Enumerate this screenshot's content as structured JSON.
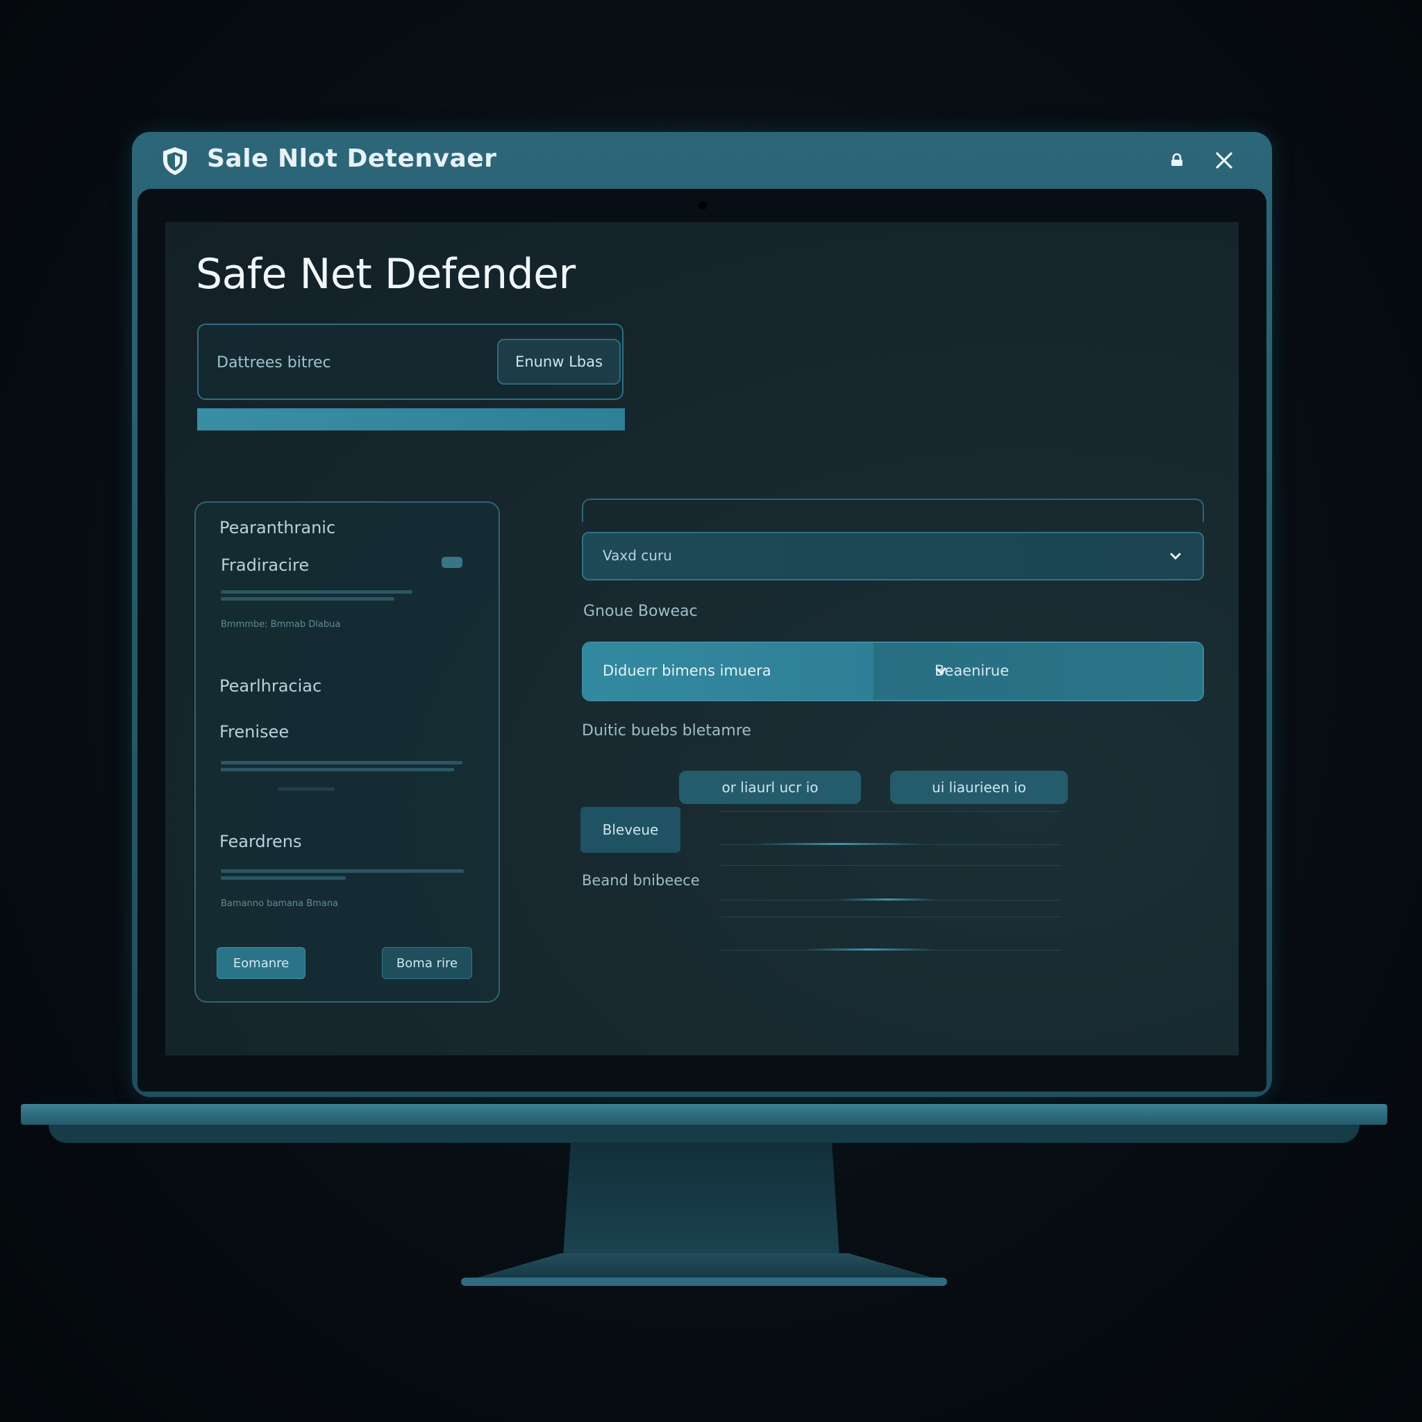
{
  "window": {
    "title": "Sale Nlot Detenvaer",
    "logo_icon": "shield-icon",
    "lock_icon": "lock-icon",
    "close_icon": "close-icon"
  },
  "page": {
    "title": "Safe Net Defender"
  },
  "top_panel": {
    "label": "Dattrees bitrec",
    "button_label": "Enunw Lbas",
    "progress": 1.0
  },
  "side_card": {
    "heading": "Pearanthranic",
    "section_1": "Fradiracire",
    "section_1_caption": "Bmmmbe: Bmmab Dlabua",
    "section_2": "Pearlhraciac",
    "section_3": "Frenisee",
    "section_4": "Feardrens",
    "section_4_caption": "Bamanno bamana Bmana",
    "primary_button": "Eomanre",
    "secondary_button": "Boma rire",
    "card_icon": "wallet-icon"
  },
  "right_panel": {
    "select_1_value": "Vaxd curu",
    "label_1": "Gnoue Boweac",
    "split_left": "Diduerr bimens imuera",
    "split_right": "Beaenirue",
    "label_2": "Duitic buebs bletamre",
    "pill_1": "or liaurl ucr io",
    "pill_2": "ui liaurieen io",
    "small_button": "Bleveue",
    "label_3": "Beand bnibeece"
  },
  "colors": {
    "accent": "#3389a0",
    "frame": "#2c6679",
    "screen_bg": "#16262c",
    "text_primary": "#f1f7f9"
  }
}
